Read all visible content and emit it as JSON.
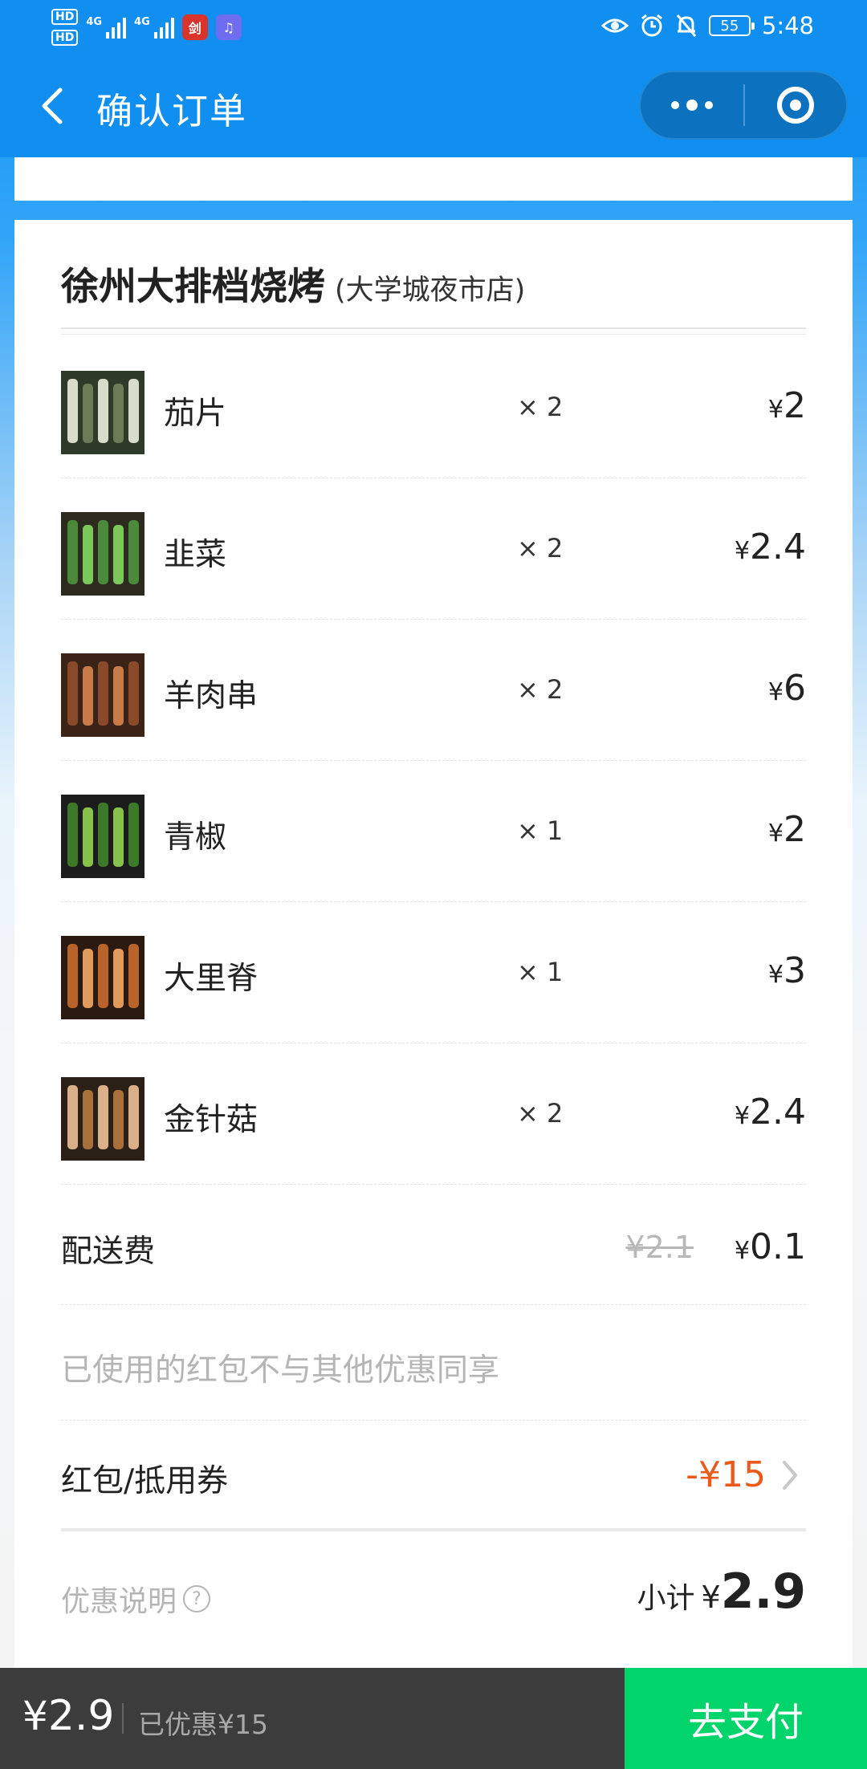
{
  "status_bar": {
    "hd_1": "HD",
    "hd_2": "HD",
    "net_1": "4G",
    "net_2": "4G",
    "app_badge": "剑",
    "battery": "55",
    "time": "5:48"
  },
  "nav": {
    "title": "确认订单"
  },
  "shop": {
    "name": "徐州大排档烧烤",
    "branch": "(大学城夜市店)"
  },
  "items": [
    {
      "name": "茄片",
      "qty": "× 2",
      "price": "2",
      "thumb_colors": [
        "#d8dccb",
        "#6d7a55",
        "#2f3a2a"
      ]
    },
    {
      "name": "韭菜",
      "qty": "× 2",
      "price": "2.4",
      "thumb_colors": [
        "#4a8a3a",
        "#7cc75a",
        "#2d2a20"
      ]
    },
    {
      "name": "羊肉串",
      "qty": "× 2",
      "price": "6",
      "thumb_colors": [
        "#8a4a2a",
        "#c87b48",
        "#3a2418"
      ]
    },
    {
      "name": "青椒",
      "qty": "× 1",
      "price": "2",
      "thumb_colors": [
        "#3c7a2a",
        "#88c24a",
        "#1c1c1c"
      ]
    },
    {
      "name": "大里脊",
      "qty": "× 1",
      "price": "3",
      "thumb_colors": [
        "#b8642a",
        "#e09a5a",
        "#2a1a12"
      ]
    },
    {
      "name": "金针菇",
      "qty": "× 2",
      "price": "2.4",
      "thumb_colors": [
        "#d9b08a",
        "#a8703a",
        "#2a2018"
      ]
    }
  ],
  "currency": "¥",
  "delivery": {
    "label": "配送费",
    "original": "¥2.1",
    "price": "0.1"
  },
  "notice": "已使用的红包不与其他优惠同享",
  "coupon": {
    "label": "红包/抵用券",
    "value": "-¥15"
  },
  "summary": {
    "promo_label": "优惠说明",
    "promo_icon": "?",
    "subtotal_label": "小计",
    "subtotal_value": "2.9"
  },
  "bottom": {
    "total": "2.9",
    "saved": "已优惠¥15",
    "pay_label": "去支付"
  },
  "colors": {
    "nav": "#118ff0",
    "coupon_red": "#ea5a1a",
    "pay_green": "#00d46a",
    "bottom_bar": "#3c3c3c"
  }
}
